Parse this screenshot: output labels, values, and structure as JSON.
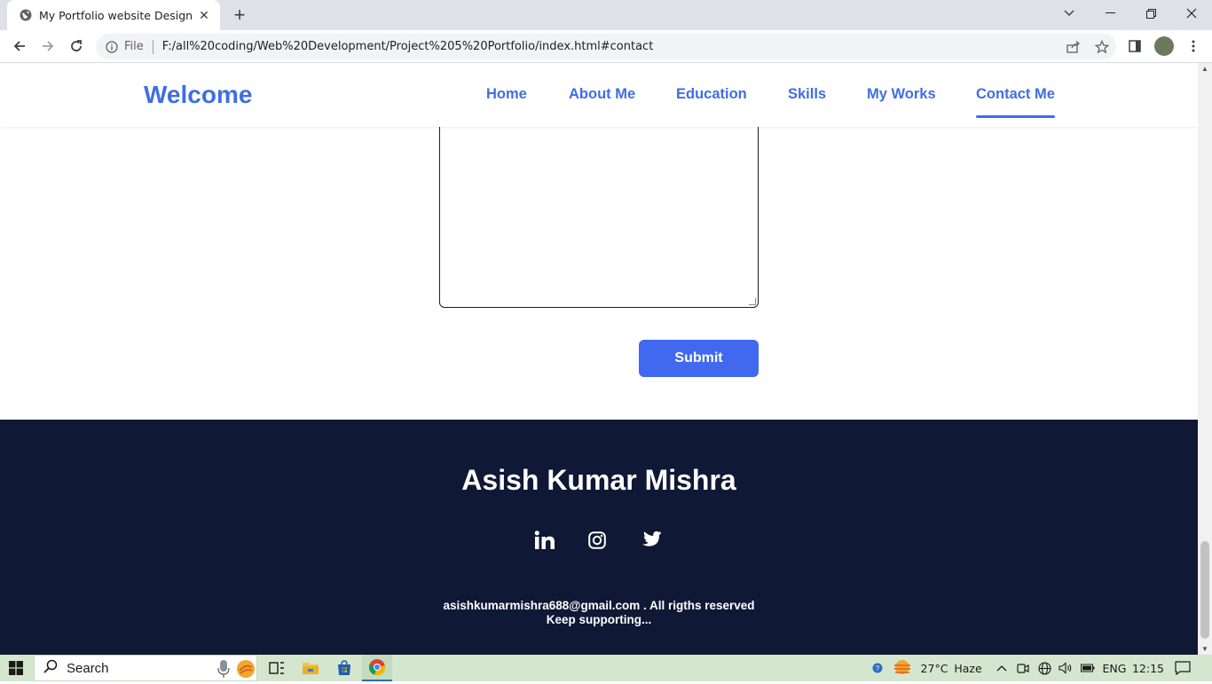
{
  "browser": {
    "tab_title": "My Portfolio website Design",
    "omnibox_scheme": "File",
    "url": "F:/all%20coding/Web%20Development/Project%205%20Portfolio/index.html#contact"
  },
  "site": {
    "brand": "Welcome",
    "nav": [
      {
        "label": "Home"
      },
      {
        "label": "About Me"
      },
      {
        "label": "Education"
      },
      {
        "label": "Skills"
      },
      {
        "label": "My Works"
      },
      {
        "label": "Contact Me",
        "active": true
      }
    ],
    "contact": {
      "message_value": "",
      "submit_label": "Submit"
    },
    "footer": {
      "name": "Asish Kumar Mishra",
      "social_icons": [
        "linkedin-icon",
        "instagram-icon",
        "twitter-icon"
      ],
      "copyright": "asishkumarmishra688@gmail.com . All rigths reserved",
      "tagline": "Keep supporting..."
    },
    "colors": {
      "accent": "#3f6ee3",
      "button": "#4169f0",
      "footer_bg": "#0f1834"
    }
  },
  "taskbar": {
    "search_label": "Search",
    "weather_temp": "27°C",
    "weather_desc": "Haze",
    "language": "ENG",
    "time": "12:15"
  }
}
